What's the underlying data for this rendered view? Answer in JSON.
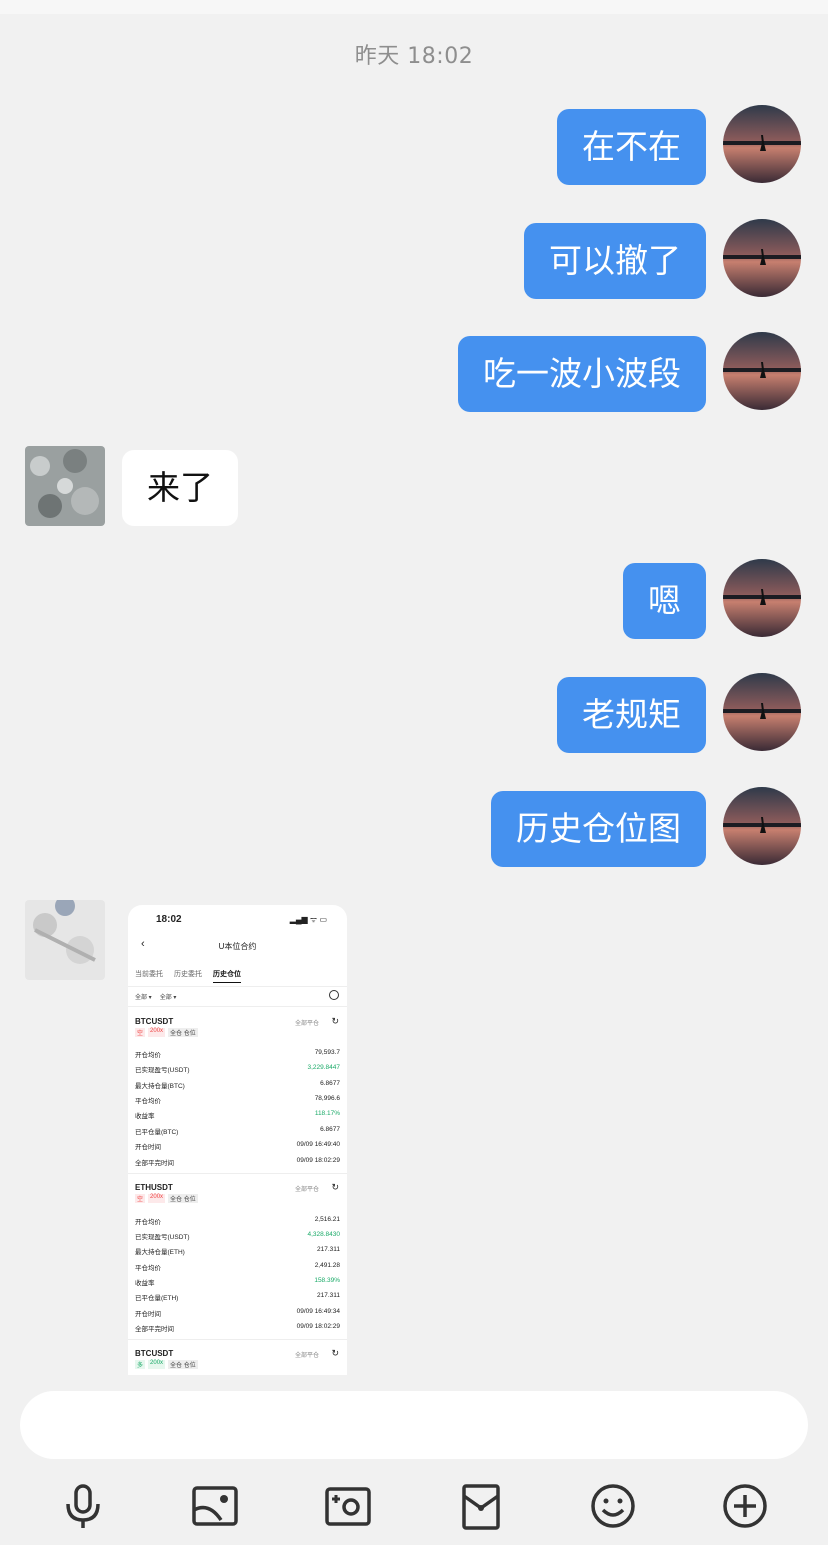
{
  "chat": {
    "timestamp": "昨天 18:02",
    "messages": [
      {
        "from": "me",
        "text": "在不在"
      },
      {
        "from": "me",
        "text": "可以撤了"
      },
      {
        "from": "me",
        "text": "吃一波小波段"
      },
      {
        "from": "other",
        "text": "来了"
      },
      {
        "from": "me",
        "text": "嗯"
      },
      {
        "from": "me",
        "text": "老规矩"
      },
      {
        "from": "me",
        "text": "历史仓位图"
      }
    ]
  },
  "screenshot": {
    "status_time": "18:02",
    "status_icons": "▂▄▆ ᯤ ▭",
    "nav_back": "‹",
    "title": "U本位合约",
    "tabs": [
      "当前委托",
      "历史委托",
      "历史仓位"
    ],
    "filters": [
      "全部 ▾",
      "全部 ▾"
    ],
    "close_all_label": "全部平仓",
    "positions": [
      {
        "symbol": "BTCUSDT",
        "side": "空",
        "leverage": "200x",
        "mode": "全仓 仓位",
        "rows": [
          {
            "k": "开仓均价",
            "v": "79,593.7"
          },
          {
            "k": "已实现盈亏(USDT)",
            "v": "3,229.8447",
            "green": true
          },
          {
            "k": "最大持仓量(BTC)",
            "v": "6.8677"
          },
          {
            "k": "平仓均价",
            "v": "78,996.6"
          },
          {
            "k": "收益率",
            "v": "118.17%",
            "green": true
          },
          {
            "k": "已平仓量(BTC)",
            "v": "6.8677"
          },
          {
            "k": "开仓时间",
            "v": "09/09 16:49:40"
          },
          {
            "k": "全部平完时间",
            "v": "09/09 18:02:29"
          }
        ]
      },
      {
        "symbol": "ETHUSDT",
        "side": "空",
        "leverage": "200x",
        "mode": "全仓 仓位",
        "rows": [
          {
            "k": "开仓均价",
            "v": "2,516.21"
          },
          {
            "k": "已实现盈亏(USDT)",
            "v": "4,328.8430",
            "green": true
          },
          {
            "k": "最大持仓量(ETH)",
            "v": "217.311"
          },
          {
            "k": "平仓均价",
            "v": "2,491.28"
          },
          {
            "k": "收益率",
            "v": "158.39%",
            "green": true
          },
          {
            "k": "已平仓量(ETH)",
            "v": "217.311"
          },
          {
            "k": "开仓时间",
            "v": "09/09 16:49:34"
          },
          {
            "k": "全部平完时间",
            "v": "09/09 18:02:29"
          }
        ]
      },
      {
        "symbol": "BTCUSDT",
        "side": "多",
        "leverage": "200x",
        "mode": "全仓 仓位",
        "rows": []
      }
    ]
  },
  "toolbar": {
    "icons": [
      "microphone-icon",
      "image-icon",
      "camera-icon",
      "red-packet-icon",
      "emoji-icon",
      "plus-icon"
    ]
  },
  "colors": {
    "bubble_out": "#4591ef",
    "bubble_in": "#ffffff",
    "background": "#f1f1f1"
  }
}
